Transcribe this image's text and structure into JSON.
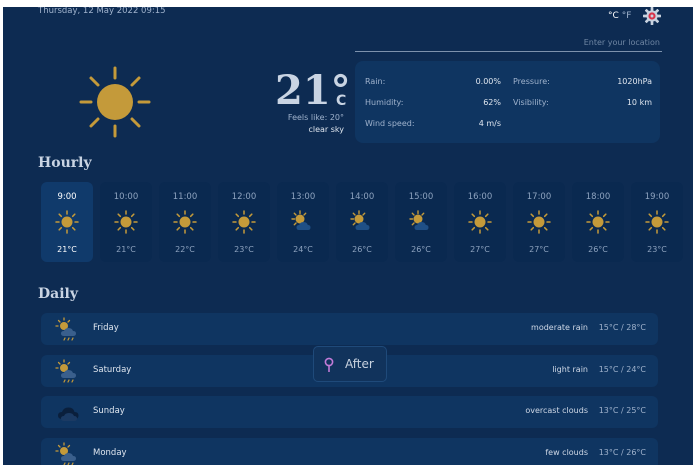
{
  "header": {
    "datetime": "Thursday, 12 May 2022 09:15",
    "unit_c": "°C",
    "unit_f": "°F",
    "settings_icon": "gear-icon",
    "location_placeholder": "Enter your location"
  },
  "current": {
    "icon": "sun-icon",
    "temp": "21°",
    "temp_unit": "C",
    "feels_like": "Feels like: 20°",
    "description": "clear sky"
  },
  "stats": {
    "rain_label": "Rain:",
    "rain_value": "0.00%",
    "humidity_label": "Humidity:",
    "humidity_value": "62%",
    "wind_label": "Wind speed:",
    "wind_value": "4 m/s",
    "pressure_label": "Pressure:",
    "pressure_value": "1020hPa",
    "visibility_label": "Visibility:",
    "visibility_value": "10 km"
  },
  "hourly": {
    "title": "Hourly",
    "items": [
      {
        "time": "9:00",
        "temp": "21°C",
        "icon": "sun-icon"
      },
      {
        "time": "10:00",
        "temp": "21°C",
        "icon": "sun-icon"
      },
      {
        "time": "11:00",
        "temp": "22°C",
        "icon": "sun-icon"
      },
      {
        "time": "12:00",
        "temp": "23°C",
        "icon": "sun-icon"
      },
      {
        "time": "13:00",
        "temp": "24°C",
        "icon": "partly-cloudy-icon"
      },
      {
        "time": "14:00",
        "temp": "26°C",
        "icon": "partly-cloudy-icon"
      },
      {
        "time": "15:00",
        "temp": "26°C",
        "icon": "partly-cloudy-icon"
      },
      {
        "time": "16:00",
        "temp": "27°C",
        "icon": "sun-icon"
      },
      {
        "time": "17:00",
        "temp": "27°C",
        "icon": "sun-icon"
      },
      {
        "time": "18:00",
        "temp": "26°C",
        "icon": "sun-icon"
      },
      {
        "time": "19:00",
        "temp": "23°C",
        "icon": "sun-icon"
      }
    ]
  },
  "daily": {
    "title": "Daily",
    "items": [
      {
        "day": "Friday",
        "desc": "moderate rain",
        "range": "15°C / 28°C",
        "icon": "sun-rain-icon"
      },
      {
        "day": "Saturday",
        "desc": "light rain",
        "range": "15°C / 24°C",
        "icon": "sun-rain-icon"
      },
      {
        "day": "Sunday",
        "desc": "overcast clouds",
        "range": "13°C / 25°C",
        "icon": "overcast-clouds-icon"
      },
      {
        "day": "Monday",
        "desc": "few clouds",
        "range": "13°C / 26°C",
        "icon": "sun-rain-icon"
      }
    ]
  },
  "overlay": {
    "label": "After",
    "icon": "pin-icon"
  },
  "colors": {
    "background": "#0d2b52",
    "panel": "#0f3561",
    "sun": "#c49a3a",
    "gear_accent": "#d9334a",
    "pin": "#c27bd8"
  }
}
